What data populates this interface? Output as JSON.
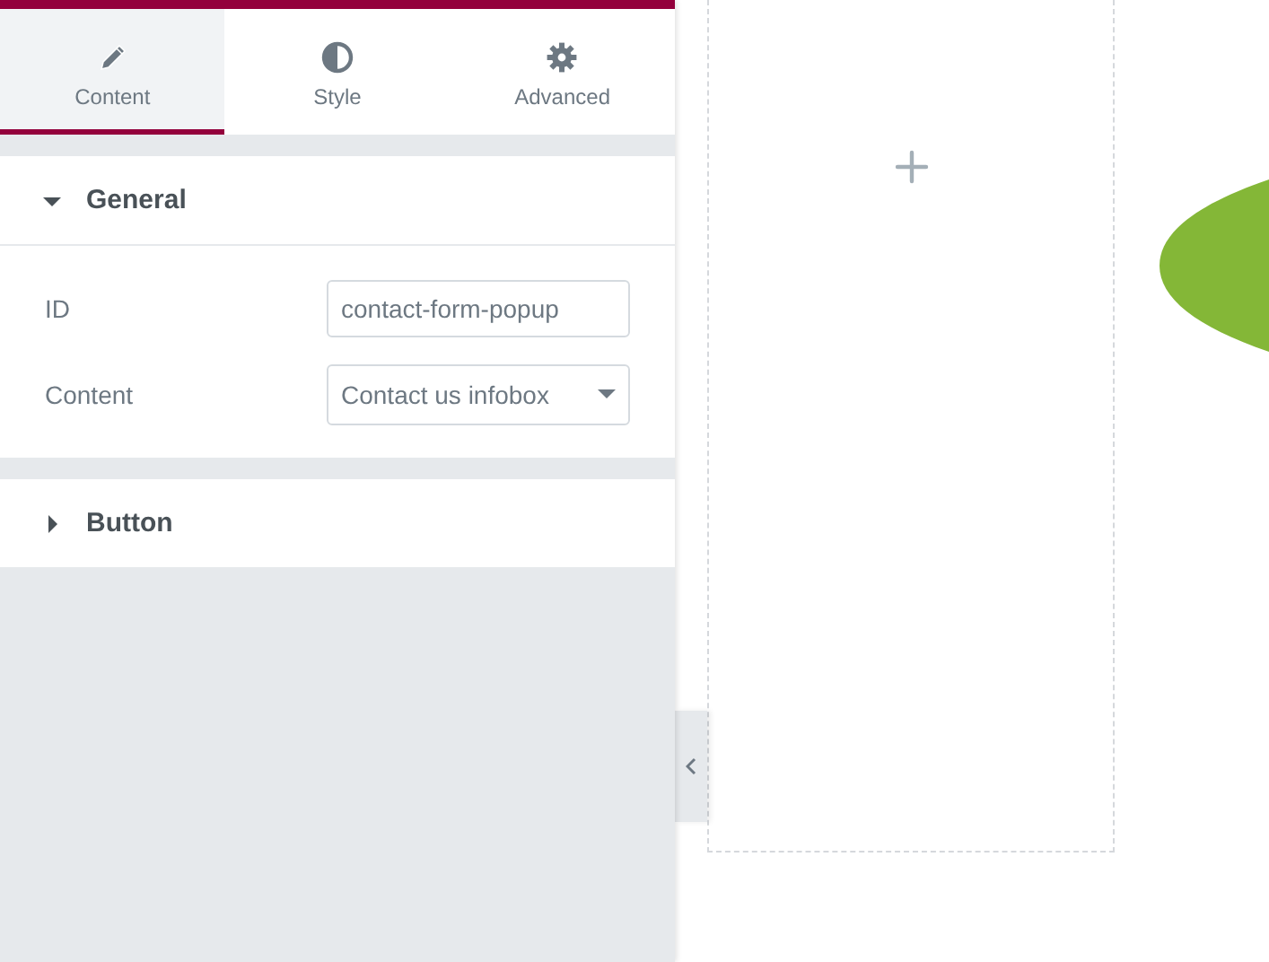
{
  "tabs": [
    {
      "label": "Content",
      "selected": true
    },
    {
      "label": "Style",
      "selected": false
    },
    {
      "label": "Advanced",
      "selected": false
    }
  ],
  "sections": [
    {
      "title": "General",
      "expanded": true,
      "fields": [
        {
          "kind": "text",
          "label": "ID",
          "value": "contact-form-popup"
        },
        {
          "kind": "select",
          "label": "Content",
          "value": "Contact us infobox"
        }
      ]
    },
    {
      "title": "Button",
      "expanded": false
    }
  ]
}
